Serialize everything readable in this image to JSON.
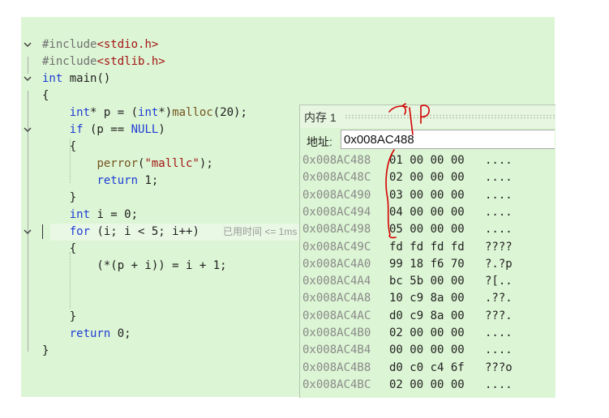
{
  "editor": {
    "lines": [
      [
        {
          "t": "#include",
          "c": "pp"
        },
        {
          "t": "<stdio.h>",
          "c": "inc"
        }
      ],
      [
        {
          "t": "#include",
          "c": "pp"
        },
        {
          "t": "<stdlib.h>",
          "c": "inc"
        }
      ],
      [
        {
          "t": "int",
          "c": "kw"
        },
        {
          "t": " main()",
          "c": ""
        }
      ],
      [
        {
          "t": "{",
          "c": ""
        }
      ],
      [
        {
          "t": "    ",
          "c": ""
        },
        {
          "t": "int",
          "c": "kw"
        },
        {
          "t": "* p = (",
          "c": ""
        },
        {
          "t": "int",
          "c": "kw"
        },
        {
          "t": "*)",
          "c": ""
        },
        {
          "t": "malloc",
          "c": "fn"
        },
        {
          "t": "(20);",
          "c": ""
        }
      ],
      [
        {
          "t": "    ",
          "c": ""
        },
        {
          "t": "if",
          "c": "kw"
        },
        {
          "t": " (p == ",
          "c": ""
        },
        {
          "t": "NULL",
          "c": "kw"
        },
        {
          "t": ")",
          "c": ""
        }
      ],
      [
        {
          "t": "    {",
          "c": ""
        }
      ],
      [
        {
          "t": "        ",
          "c": ""
        },
        {
          "t": "perror",
          "c": "fn"
        },
        {
          "t": "(",
          "c": ""
        },
        {
          "t": "\"malllc\"",
          "c": "str"
        },
        {
          "t": ");",
          "c": ""
        }
      ],
      [
        {
          "t": "        ",
          "c": ""
        },
        {
          "t": "return",
          "c": "kw"
        },
        {
          "t": " 1;",
          "c": ""
        }
      ],
      [
        {
          "t": "    }",
          "c": ""
        }
      ],
      [
        {
          "t": "    ",
          "c": ""
        },
        {
          "t": "int",
          "c": "kw"
        },
        {
          "t": " i = 0;",
          "c": ""
        }
      ],
      [
        {
          "t": "    ",
          "c": ""
        },
        {
          "t": "for",
          "c": "kw"
        },
        {
          "t": " (i; i < 5; i++)",
          "c": ""
        }
      ],
      [
        {
          "t": "    {",
          "c": ""
        }
      ],
      [
        {
          "t": "        (*(p + i)) = i + 1;",
          "c": ""
        }
      ],
      [],
      [],
      [
        {
          "t": "    }",
          "c": ""
        }
      ],
      [
        {
          "t": "    ",
          "c": ""
        },
        {
          "t": "return",
          "c": "kw"
        },
        {
          "t": " 0;",
          "c": ""
        }
      ],
      [
        {
          "t": "}",
          "c": ""
        }
      ]
    ],
    "elapsed_hint": "已用时间 <= 1ms"
  },
  "memory_window": {
    "title": "内存 1",
    "address_label": "地址:",
    "address_value": "0x008AC488",
    "rows": [
      {
        "addr": "0x008AC488",
        "bytes": "01 00 00 00",
        "ascii": "...."
      },
      {
        "addr": "0x008AC48C",
        "bytes": "02 00 00 00",
        "ascii": "...."
      },
      {
        "addr": "0x008AC490",
        "bytes": "03 00 00 00",
        "ascii": "...."
      },
      {
        "addr": "0x008AC494",
        "bytes": "04 00 00 00",
        "ascii": "...."
      },
      {
        "addr": "0x008AC498",
        "bytes": "05 00 00 00",
        "ascii": "...."
      },
      {
        "addr": "0x008AC49C",
        "bytes": "fd fd fd fd",
        "ascii": "????"
      },
      {
        "addr": "0x008AC4A0",
        "bytes": "99 18 f6 70",
        "ascii": "?.?p"
      },
      {
        "addr": "0x008AC4A4",
        "bytes": "bc 5b 00 00",
        "ascii": "?[.."
      },
      {
        "addr": "0x008AC4A8",
        "bytes": "10 c9 8a 00",
        "ascii": ".??."
      },
      {
        "addr": "0x008AC4AC",
        "bytes": "d0 c9 8a 00",
        "ascii": "???."
      },
      {
        "addr": "0x008AC4B0",
        "bytes": "02 00 00 00",
        "ascii": "...."
      },
      {
        "addr": "0x008AC4B4",
        "bytes": "00 00 00 00",
        "ascii": "...."
      },
      {
        "addr": "0x008AC4B8",
        "bytes": "d0 c0 c4 6f",
        "ascii": "???o"
      },
      {
        "addr": "0x008AC4BC",
        "bytes": "02 00 00 00",
        "ascii": "...."
      }
    ]
  },
  "colors": {
    "accent_red": "#d40000"
  }
}
